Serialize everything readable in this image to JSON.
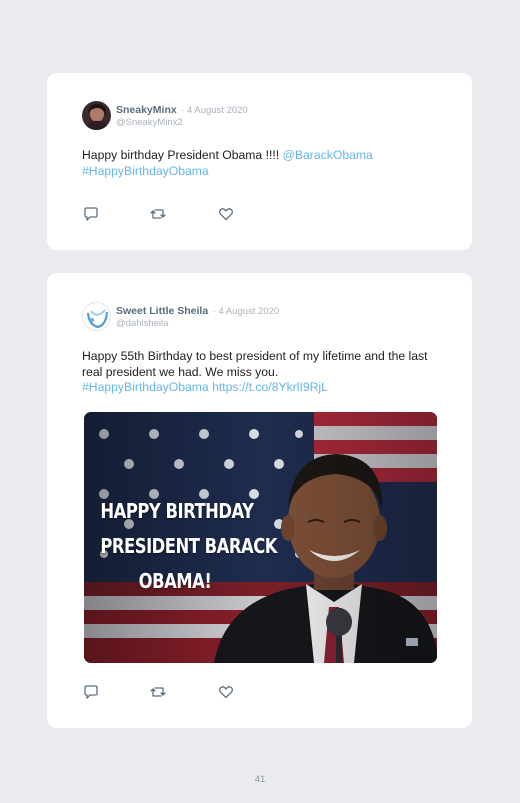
{
  "page": {
    "number": "41"
  },
  "tweets": [
    {
      "name": "SneakyMinx",
      "date": "· 4 August 2020",
      "handle": "@SneakyMinx2",
      "text": "Happy birthday President Obama !!!! ",
      "mention": "@BarackObama",
      "hashtag": "#HappyBirthdayObama"
    },
    {
      "name": "Sweet Little Sheila",
      "date": "· 4 August 2020",
      "handle": "@dahlsheila",
      "text": "Happy 55th Birthday to best president of my lifetime and the last real president we had. We miss you.",
      "hashtag": "#HappyBirthdayObama",
      "url": "https://t.co/8YkrlI9RjL",
      "image_caption": [
        "HAPPY BIRTHDAY",
        "PRESIDENT BARACK",
        "OBAMA!"
      ]
    }
  ],
  "icons": {
    "reply": "reply-icon",
    "retweet": "retweet-icon",
    "like": "like-icon"
  },
  "colors": {
    "link": "#64b5e9",
    "background": "#e9ebee",
    "card": "#ffffff"
  }
}
